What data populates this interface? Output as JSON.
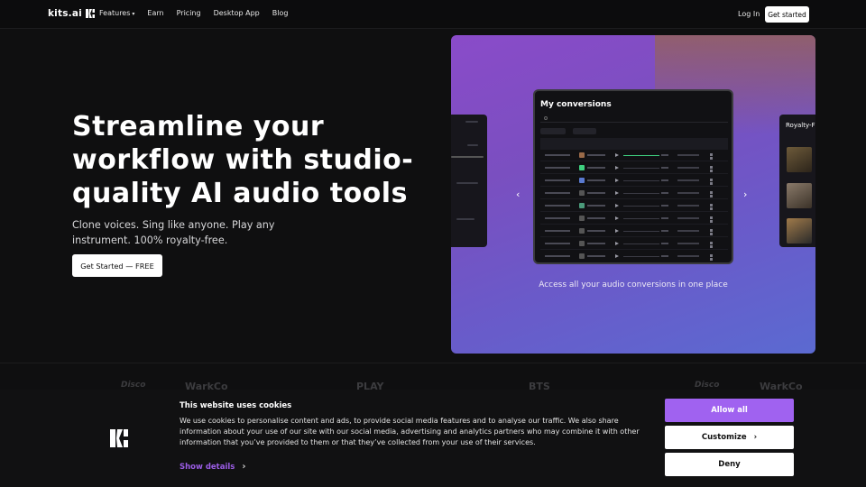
{
  "nav": {
    "logo_text": "kits.ai",
    "links": [
      "Features",
      "Earn",
      "Pricing",
      "Desktop App",
      "Blog"
    ],
    "login": "Log In",
    "get_started": "Get started"
  },
  "hero": {
    "title": "Streamline your workflow with studio-quality AI audio tools",
    "subtitle": "Clone voices. Sing like anyone. Play any instrument.  100% royalty-free.",
    "cta": "Get Started — FREE"
  },
  "showcase": {
    "card_title": "My conversions",
    "right_card_title": "Royalty-F",
    "caption": "Access all your audio conversions in one place",
    "prev_icon": "chevron-left-icon",
    "next_icon": "chevron-right-icon"
  },
  "partners": [
    "Disco",
    "WarkCo",
    "PLAY",
    "BTS",
    "Disco",
    "WarkCo"
  ],
  "cookie": {
    "title": "This website uses cookies",
    "text": "We use cookies to personalise content and ads, to provide social media features and to analyse our traffic. We also share information about your use of our site with our social media, advertising and analytics partners who may combine it with other information that you’ve provided to them or that they’ve collected from your use of their services.",
    "show_details": "Show details",
    "allow_all": "Allow all",
    "customize": "Customize",
    "deny": "Deny"
  },
  "colors": {
    "accent": "#a062f0",
    "link": "#9b5de5",
    "background": "#0f0f10"
  }
}
